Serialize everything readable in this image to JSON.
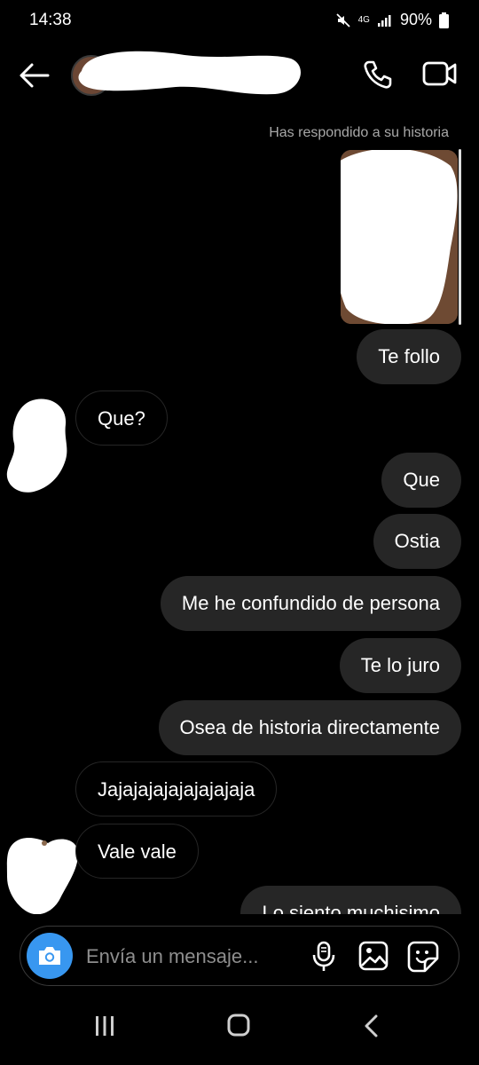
{
  "status_bar": {
    "time": "14:38",
    "network": "4G",
    "battery": "90%"
  },
  "header": {
    "contact_name": "",
    "back_icon": "arrow-left-icon",
    "call_icon": "phone-icon",
    "video_icon": "video-camera-icon"
  },
  "chat": {
    "story_note": "Has respondido a su historia",
    "messages": [
      {
        "direction": "out",
        "text": "Te follo"
      },
      {
        "direction": "in",
        "text": "Que?"
      },
      {
        "direction": "out",
        "text": "Que"
      },
      {
        "direction": "out",
        "text": "Ostia"
      },
      {
        "direction": "out",
        "text": "Me he confundido de persona"
      },
      {
        "direction": "out",
        "text": "Te lo juro"
      },
      {
        "direction": "out",
        "text": "Osea de historia directamente"
      },
      {
        "direction": "in",
        "text": "Jajajajajajajajajaja"
      },
      {
        "direction": "in",
        "text": "Vale vale"
      },
      {
        "direction": "out",
        "text": "Lo siento muchisimo"
      }
    ]
  },
  "composer": {
    "placeholder": "Envía un mensaje...",
    "camera_icon": "camera-icon",
    "mic_icon": "microphone-icon",
    "gallery_icon": "image-icon",
    "sticker_icon": "sticker-icon"
  },
  "colors": {
    "background": "#000000",
    "bubble": "#262626",
    "accent": "#3897f0",
    "meta_text": "#a8a8a8"
  }
}
